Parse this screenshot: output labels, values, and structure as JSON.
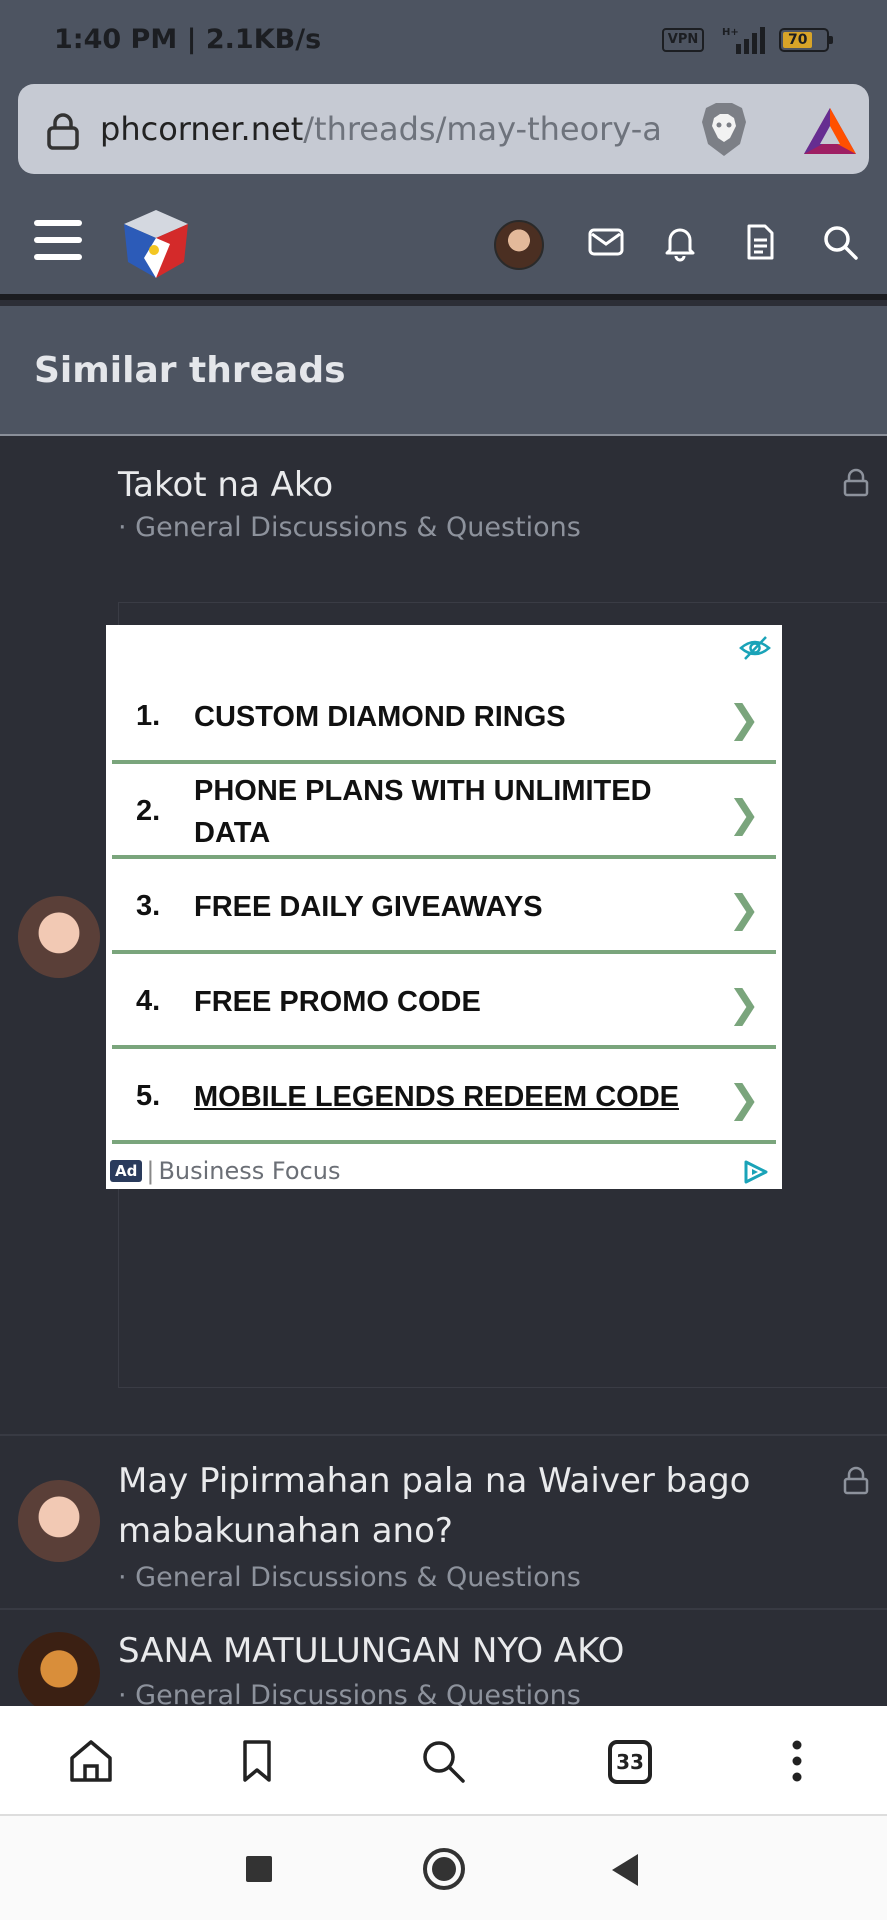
{
  "status_bar": {
    "time": "1:40 PM | 2.1KB/s",
    "vpn": "VPN",
    "battery": "70"
  },
  "browser": {
    "url_host": "phcorner.net",
    "url_path": "/threads/may-theory-a",
    "tab_count": "33"
  },
  "site_header": {
    "icons": [
      "menu-icon",
      "site-logo",
      "user-avatar",
      "mail-icon",
      "bell-icon",
      "document-icon",
      "search-icon"
    ]
  },
  "section": {
    "title": "Similar threads"
  },
  "threads": [
    {
      "title": "Takot na Ako",
      "forum": "· General Discussions & Questions",
      "locked": true
    },
    {
      "title": "May Pipirmahan pala na Waiver bago mabakunahan ano?",
      "forum": "· General Discussions & Questions",
      "locked": true
    },
    {
      "title": "SANA MATULUNGAN NYO AKO",
      "forum": "· General Discussions & Questions",
      "locked": false
    }
  ],
  "ad": {
    "items": [
      {
        "num": "1.",
        "label": "CUSTOM DIAMOND RINGS"
      },
      {
        "num": "2.",
        "label": "PHONE PLANS WITH UNLIMITED DATA"
      },
      {
        "num": "3.",
        "label": "FREE DAILY GIVEAWAYS"
      },
      {
        "num": "4.",
        "label": "FREE PROMO CODE"
      },
      {
        "num": "5.",
        "label": "MOBILE LEGENDS REDEEM CODE"
      }
    ],
    "badge": "Ad",
    "separator": "|",
    "brand": "Business Focus",
    "accent_color": "#7aa57c"
  }
}
